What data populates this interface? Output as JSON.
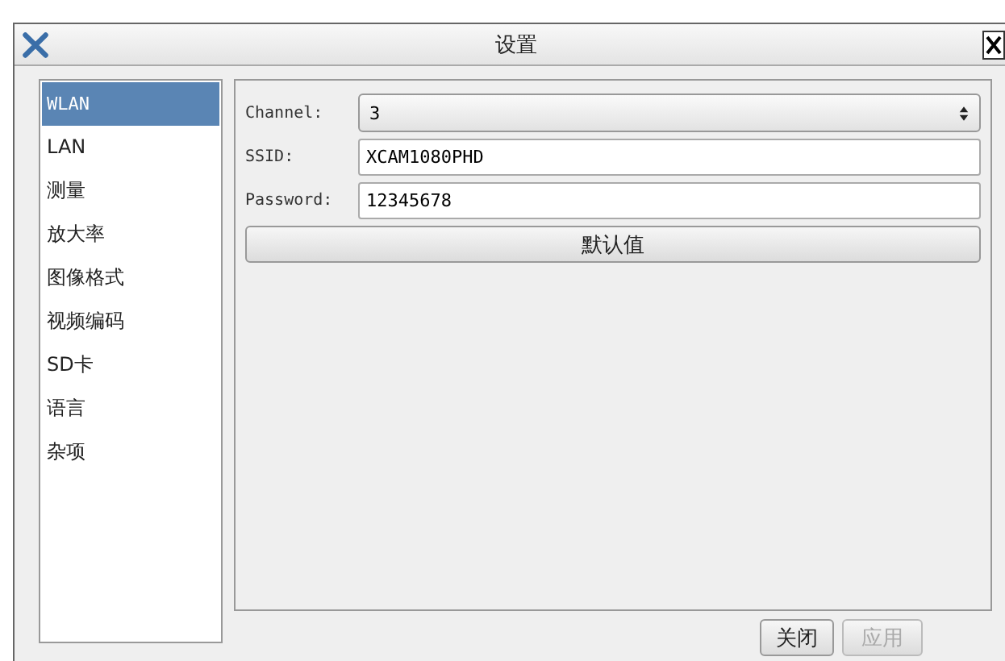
{
  "window": {
    "title": "设置"
  },
  "sidebar": {
    "items": [
      {
        "label": "WLAN",
        "selected": true
      },
      {
        "label": "LAN",
        "selected": false
      },
      {
        "label": "测量",
        "selected": false
      },
      {
        "label": "放大率",
        "selected": false
      },
      {
        "label": "图像格式",
        "selected": false
      },
      {
        "label": "视频编码",
        "selected": false
      },
      {
        "label": "SD卡",
        "selected": false
      },
      {
        "label": "语言",
        "selected": false
      },
      {
        "label": "杂项",
        "selected": false
      }
    ]
  },
  "form": {
    "fields": [
      {
        "kind": "select",
        "label": "Channel:",
        "value": "3"
      },
      {
        "kind": "text",
        "label": "SSID:",
        "value": "XCAM1080PHD"
      },
      {
        "kind": "text",
        "label": "Password:",
        "value": "12345678"
      }
    ],
    "default_button": "默认值"
  },
  "buttons": [
    {
      "label": "关闭",
      "disabled": false
    },
    {
      "label": "应用",
      "disabled": true
    }
  ]
}
